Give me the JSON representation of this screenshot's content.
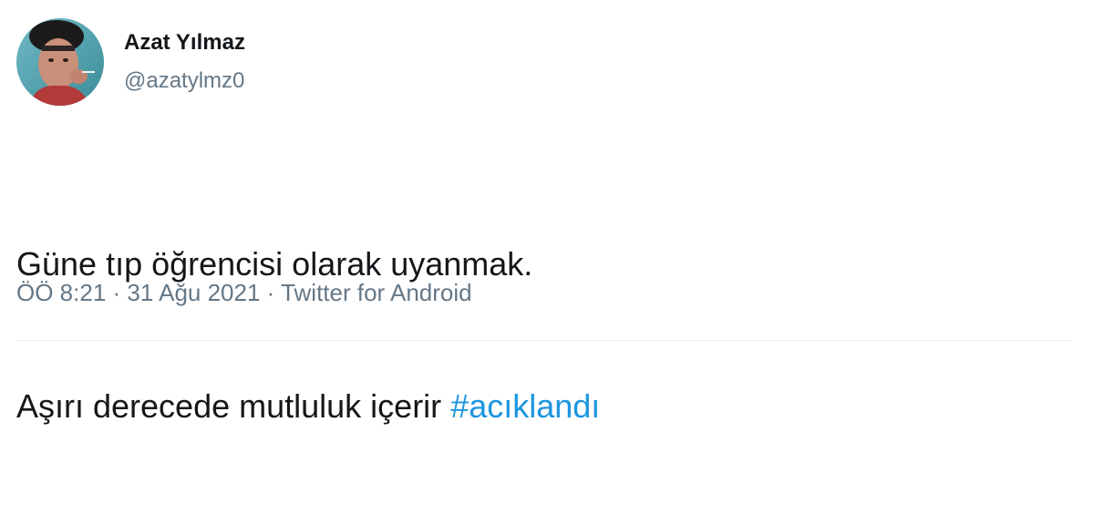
{
  "author": {
    "display_name": "Azat Yılmaz",
    "handle": "@azatylmz0"
  },
  "tweet": {
    "line1": "Güne tıp öğrencisi olarak uyanmak.",
    "line2_prefix": "Aşırı derecede mutluluk içerir ",
    "hashtag": "#acıklandı"
  },
  "meta": {
    "time": "ÖÖ 8:21",
    "separator": " · ",
    "date": "31 Ağu 2021",
    "source": "Twitter for Android"
  },
  "colors": {
    "text": "#14171a",
    "secondary": "#657786",
    "link": "#1b95e0",
    "divider": "#e6ecf0"
  }
}
